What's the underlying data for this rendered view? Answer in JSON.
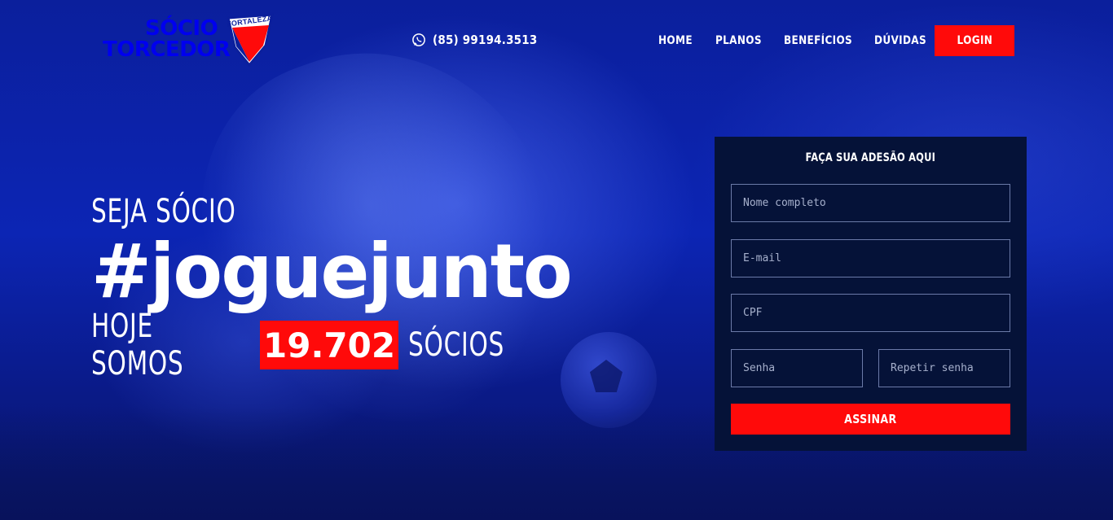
{
  "brand": {
    "line1": "SÓCIO",
    "line2": "TORCEDOR",
    "shield_label": "FORTALEZA",
    "colors": {
      "blue": "#0b1f9c",
      "red": "#ff0a0a",
      "navy": "#051238"
    }
  },
  "header": {
    "phone_icon": "whatsapp-icon",
    "phone": "(85) 99194.3513",
    "nav": [
      {
        "label": "HOME"
      },
      {
        "label": "PLANOS"
      },
      {
        "label": "BENEFÍCIOS"
      },
      {
        "label": "DÚVIDAS"
      }
    ],
    "login_label": "LOGIN"
  },
  "hero": {
    "kicker": "SEJA SÓCIO",
    "hashtag": "#joguejunto",
    "count_prefix": "HOJE SOMOS",
    "count": "19.702",
    "count_suffix": "SÓCIOS"
  },
  "form": {
    "title": "FAÇA SUA ADESÃO AQUI",
    "fields": {
      "name_placeholder": "Nome completo",
      "email_placeholder": "E-mail",
      "cpf_placeholder": "CPF",
      "password_placeholder": "Senha",
      "repeat_password_placeholder": "Repetir senha"
    },
    "submit_label": "ASSINAR"
  }
}
